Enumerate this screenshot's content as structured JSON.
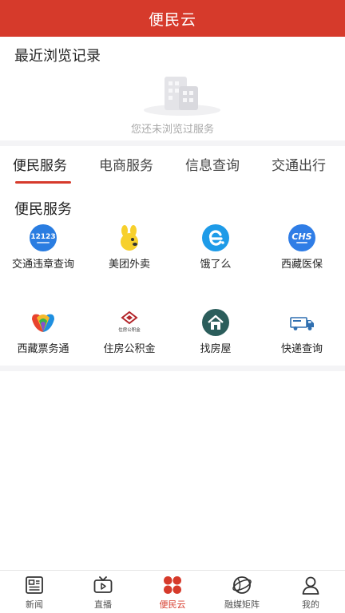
{
  "header": {
    "title": "便民云"
  },
  "recent": {
    "heading": "最近浏览记录",
    "empty_text": "您还未浏览过服务"
  },
  "tabs": [
    {
      "label": "便民服务",
      "active": true
    },
    {
      "label": "电商服务",
      "active": false
    },
    {
      "label": "信息查询",
      "active": false
    },
    {
      "label": "交通出行",
      "active": false
    }
  ],
  "section": {
    "title": "便民服务"
  },
  "services": [
    {
      "label": "交通违章查询",
      "icon": "traffic-12123-icon",
      "icon_text": "12123"
    },
    {
      "label": "美团外卖",
      "icon": "meituan-waimai-icon"
    },
    {
      "label": "饿了么",
      "icon": "eleme-icon"
    },
    {
      "label": "西藏医保",
      "icon": "xizang-yibao-icon",
      "icon_text": "CHS"
    },
    {
      "label": "西藏票务通",
      "icon": "xizang-piaowutong-icon"
    },
    {
      "label": "住房公积金",
      "icon": "housing-fund-icon",
      "icon_text": "住房公积金"
    },
    {
      "label": "找房屋",
      "icon": "house-icon"
    },
    {
      "label": "快递查询",
      "icon": "delivery-truck-icon"
    }
  ],
  "bottom_nav": [
    {
      "label": "新闻",
      "icon": "newspaper-icon",
      "active": false
    },
    {
      "label": "直播",
      "icon": "tv-icon",
      "active": false
    },
    {
      "label": "便民云",
      "icon": "clover-icon",
      "active": true
    },
    {
      "label": "融媒矩阵",
      "icon": "globe-icon",
      "active": false
    },
    {
      "label": "我的",
      "icon": "user-icon",
      "active": false
    }
  ],
  "colors": {
    "primary": "#d63a2b",
    "divider": "#f4f4f6",
    "muted_text": "#a8a8a8"
  }
}
